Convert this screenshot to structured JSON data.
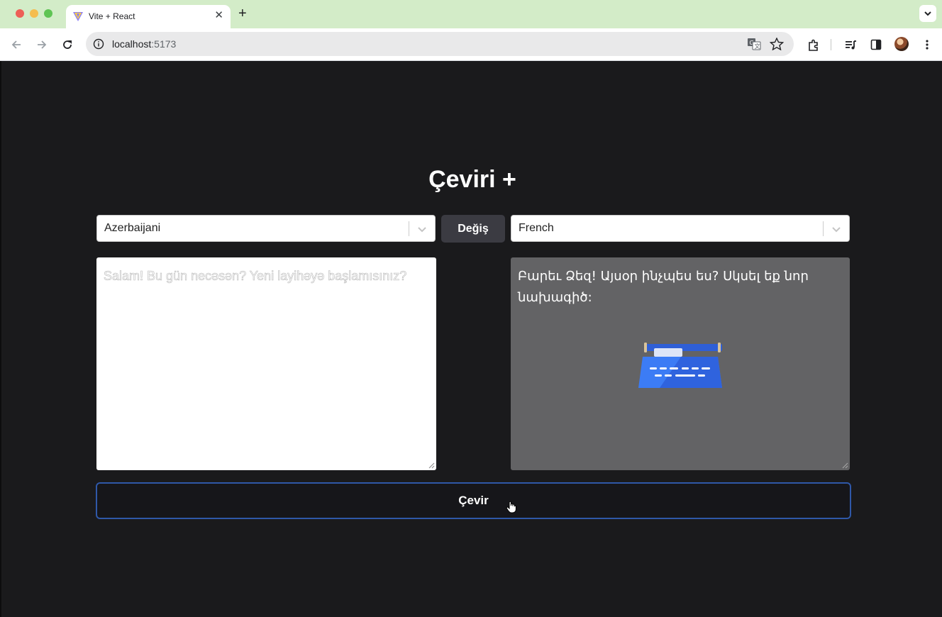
{
  "browser": {
    "tab_title": "Vite + React",
    "url_host": "localhost",
    "url_port": ":5173"
  },
  "app": {
    "title": "Çeviri +",
    "source_language": "Azerbaijani",
    "target_language": "French",
    "swap_label": "Değiş",
    "source_text": "Salam! Bu gün necəsən? Yeni layihəyə başlamısınız?",
    "translated_text": "Բարեւ Ձեզ! Այսօր ինչպես ես? Սկսել եք նոր նախագիծ:",
    "translate_label": "Çevir"
  },
  "colors": {
    "tabbar_bg": "#d3ecc8",
    "page_bg": "#1a1a1c",
    "swap_button_bg": "#3b3b42",
    "output_bg": "#636365",
    "translate_border": "#2f58a8",
    "typewriter_blue": "#3c7cf5"
  },
  "icons": [
    "back-arrow-icon",
    "forward-arrow-icon",
    "reload-icon",
    "site-info-icon",
    "translate-page-icon",
    "bookmark-star-icon",
    "extensions-icon",
    "reading-list-icon",
    "side-panel-icon",
    "kebab-menu-icon",
    "chevron-down-icon",
    "typewriter-icon",
    "hand-cursor-icon"
  ]
}
